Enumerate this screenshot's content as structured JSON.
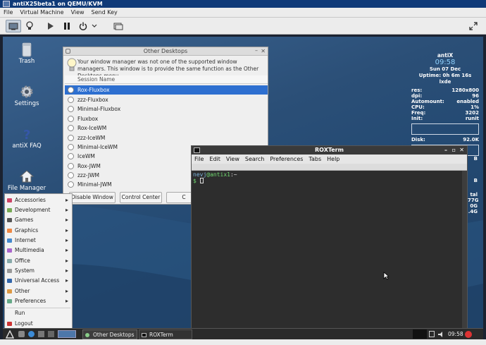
{
  "vm": {
    "title": "antiX25beta1 on QEMU/KVM",
    "menu": [
      "File",
      "Virtual Machine",
      "View",
      "Send Key"
    ]
  },
  "desktop_icons": [
    "Trash",
    "Settings",
    "antiX FAQ",
    "File Manager"
  ],
  "conky": {
    "hostname": "antiX",
    "time": "09:58",
    "date": "Sun 07 Dec",
    "uptime": "Uptime: 0h 6m 16s",
    "wm": "lxde",
    "rows": [
      {
        "k": "res:",
        "v": "1280x800"
      },
      {
        "k": "dpi:",
        "v": "96"
      },
      {
        "k": "Automount:",
        "v": "enabled"
      },
      {
        "k": "CPU:",
        "v": "1%"
      },
      {
        "k": "Freq:",
        "v": "3202"
      },
      {
        "k": "Init:",
        "v": "runit"
      }
    ],
    "disk_label": "Disk:",
    "disk_value": "92.0K",
    "partial": [
      "B",
      "B",
      "tal",
      "77G",
      "0G",
      ".4G"
    ]
  },
  "other_desktops": {
    "title": "Other Desktops",
    "message": "Your window manager was not one of the supported window managers. This window is to provide the same function as the Other Desktops menu",
    "column_header": "Session Name",
    "sessions": [
      "Rox-Fluxbox",
      "zzz-Fluxbox",
      "Minimal-Fluxbox",
      "Fluxbox",
      "Rox-IceWM",
      "zzz-IceWM",
      "Minimal-IceWM",
      "IceWM",
      "Rox-JWM",
      "zzz-JWM",
      "Minimal-JWM"
    ],
    "selected_index": 0,
    "buttons": [
      "Disable Window",
      "Control Center",
      "C"
    ]
  },
  "roxterm": {
    "title": "ROXTerm",
    "menu": [
      "File",
      "Edit",
      "View",
      "Search",
      "Preferences",
      "Tabs",
      "Help"
    ],
    "prompt_user": "nevj",
    "prompt_host": "@antix1",
    "prompt_path": ":~",
    "prompt_symbol": "$"
  },
  "start_menu": {
    "items": [
      "Accessories",
      "Development",
      "Games",
      "Graphics",
      "Internet",
      "Multimedia",
      "Office",
      "System",
      "Universal Access",
      "Other",
      "Preferences"
    ],
    "actions": [
      "Run",
      "Logout"
    ]
  },
  "taskbar": {
    "tasks": [
      "Other Desktops",
      "ROXTerm"
    ],
    "clock": "09:58"
  }
}
